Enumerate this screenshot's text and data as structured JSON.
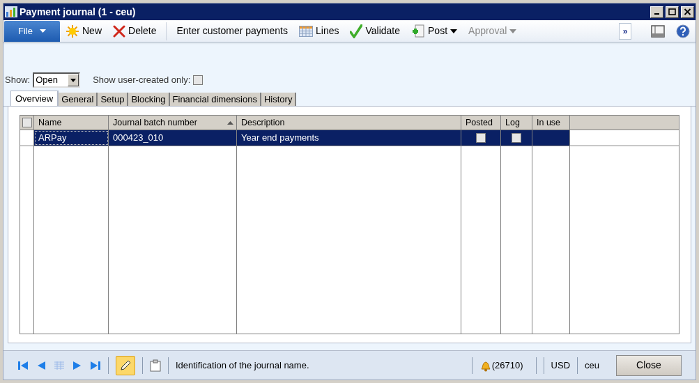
{
  "window": {
    "title": "Payment journal (1 - ceu)"
  },
  "toolbar": {
    "file": "File",
    "items": [
      {
        "label": "New",
        "dropdown": false,
        "disabled": false
      },
      {
        "label": "Delete",
        "dropdown": false,
        "disabled": false
      },
      {
        "label": "Enter customer payments",
        "dropdown": false,
        "disabled": false
      },
      {
        "label": "Lines",
        "dropdown": false,
        "disabled": false
      },
      {
        "label": "Validate",
        "dropdown": false,
        "disabled": false
      },
      {
        "label": "Post",
        "dropdown": true,
        "disabled": false
      },
      {
        "label": "Approval",
        "dropdown": true,
        "disabled": true
      }
    ],
    "more": "»"
  },
  "filter": {
    "show_label": "Show:",
    "show_value": "Open",
    "user_created_label": "Show user-created only:",
    "user_created_checked": false
  },
  "tabs": [
    {
      "label": "Overview",
      "selected": true
    },
    {
      "label": "General",
      "selected": false
    },
    {
      "label": "Setup",
      "selected": false
    },
    {
      "label": "Blocking",
      "selected": false
    },
    {
      "label": "Financial dimensions",
      "selected": false
    },
    {
      "label": "History",
      "selected": false
    }
  ],
  "grid": {
    "select_all_checked": false,
    "columns": [
      {
        "label": "Name",
        "sorted": false
      },
      {
        "label": "Journal batch number",
        "sorted": true
      },
      {
        "label": "Description",
        "sorted": false
      },
      {
        "label": "Posted",
        "sorted": false
      },
      {
        "label": "Log",
        "sorted": false
      },
      {
        "label": "In use",
        "sorted": false
      }
    ],
    "rows": [
      {
        "name": "ARPay",
        "batch": "000423_010",
        "description": "Year end payments",
        "posted": false,
        "log": false,
        "in_use": false,
        "selected": true
      }
    ]
  },
  "status_bar": {
    "edit_mode": true,
    "message": "Identification of the journal name.",
    "notifications": "(26710)",
    "currency": "USD",
    "company": "ceu",
    "close": "Close"
  }
}
